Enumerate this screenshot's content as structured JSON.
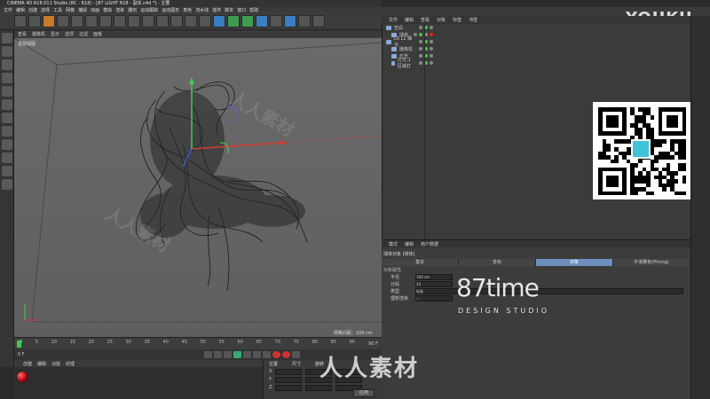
{
  "window": {
    "title": "CINEMA 4D R18.011 Studio (RC - R18) - [87 LIGHT R18 - 副本.c4d *] - 主要"
  },
  "menubar": {
    "items": [
      "文件",
      "编辑",
      "创建",
      "选择",
      "工具",
      "网格",
      "捕捉",
      "动画",
      "模拟",
      "渲染",
      "雕刻",
      "运动跟踪",
      "运动图形",
      "角色",
      "流水线",
      "插件",
      "脚本",
      "窗口",
      "帮助"
    ]
  },
  "viewport": {
    "menu": [
      "查看",
      "摄像机",
      "显示",
      "选项",
      "过滤",
      "面板"
    ],
    "label": "透视视图",
    "grid_label": "网格间距：100 cm"
  },
  "timeline": {
    "ticks": [
      "0",
      "5",
      "10",
      "15",
      "20",
      "25",
      "30",
      "35",
      "40",
      "45",
      "50",
      "55",
      "60",
      "65",
      "70",
      "75",
      "80",
      "85",
      "90"
    ],
    "frame_start": "0 F",
    "frame_end": "90 F"
  },
  "material": {
    "menu": [
      "创建",
      "编辑",
      "功能",
      "纹理"
    ]
  },
  "coords": {
    "headers": [
      "位置",
      "尺寸",
      "旋转"
    ],
    "rows": [
      {
        "axis": "X",
        "pos": "0 cm",
        "size": "0 cm",
        "rot": "H 0°"
      },
      {
        "axis": "Y",
        "pos": "0 cm",
        "size": "0 cm",
        "rot": "P 0°"
      },
      {
        "axis": "Z",
        "pos": "0 cm",
        "size": "0 cm",
        "rot": "B 0°"
      }
    ],
    "mode1": "对象(相对)",
    "mode2": "绝对尺寸",
    "apply": "应用"
  },
  "object_manager": {
    "menu": [
      "文件",
      "编辑",
      "查看",
      "对象",
      "标签",
      "书签"
    ],
    "objects": [
      {
        "label": "空白",
        "indent": 0
      },
      {
        "label": "球体",
        "indent": 1
      },
      {
        "label": "L0 L1 细分",
        "indent": 0
      },
      {
        "label": "摄像机",
        "indent": 1
      },
      {
        "label": "灯光",
        "indent": 1
      },
      {
        "label": "灯光.1 区域灯",
        "indent": 1
      }
    ]
  },
  "attributes": {
    "menu": [
      "模式",
      "编辑",
      "用户数据"
    ],
    "title": "球体对象 [球体]",
    "tabs": [
      "基本",
      "坐标",
      "对象",
      "平滑着色(Phong)"
    ],
    "active_tab": "对象",
    "section": "对象属性",
    "rows": [
      {
        "label": "半径",
        "value": "100 cm"
      },
      {
        "label": "分段",
        "value": "24"
      },
      {
        "label": "类型",
        "value": "标准"
      },
      {
        "label": "理想渲染",
        "value": "✓"
      }
    ]
  },
  "branding": {
    "youku": "YOUKU",
    "studio_big": "87time",
    "studio_small": "DESIGN STUDIO",
    "renren": "人人素材",
    "qr_center": "87time"
  },
  "colors": {
    "viewport_bg": "#656565",
    "accent": "#6c8fbd",
    "axis_x": "#d33b2c",
    "axis_y": "#3ecb4f",
    "axis_z": "#3c58c9"
  }
}
